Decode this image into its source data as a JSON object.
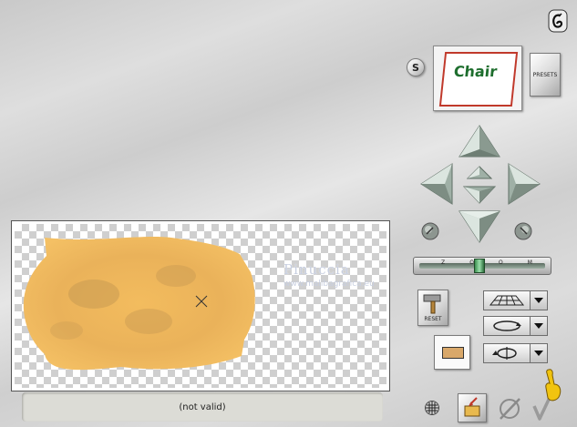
{
  "status": {
    "text": "(not valid)"
  },
  "toolbar": {
    "presets_label": "PRESETS",
    "s_button_label": "S",
    "reset_label": "RESET"
  },
  "zoom_slider": {
    "labels": [
      "Z",
      "O",
      "O",
      "M"
    ],
    "level": 0.47
  },
  "thumbnail": {
    "text": "Chair"
  },
  "watermark": {
    "name": "Pinuccia",
    "url": "www.malibagrafica.eu"
  },
  "colors": {
    "shape_fill": "#f2b95a",
    "shape_shadow": "#c99a4e",
    "background": "#d6d6d6"
  },
  "icons": {
    "help": "help-icon",
    "grid": "grid-icon",
    "open_folder": "open-folder-icon",
    "cancel": "cancel-icon",
    "ok": "ok-checkmark-icon",
    "finger": "pointing-hand-icon",
    "perspective": "perspective-plane-icon",
    "rotate_horizontal": "rotate-horizontal-icon",
    "rotate_vertical": "rotate-vertical-icon",
    "swatch": "color-swatch-icon"
  }
}
